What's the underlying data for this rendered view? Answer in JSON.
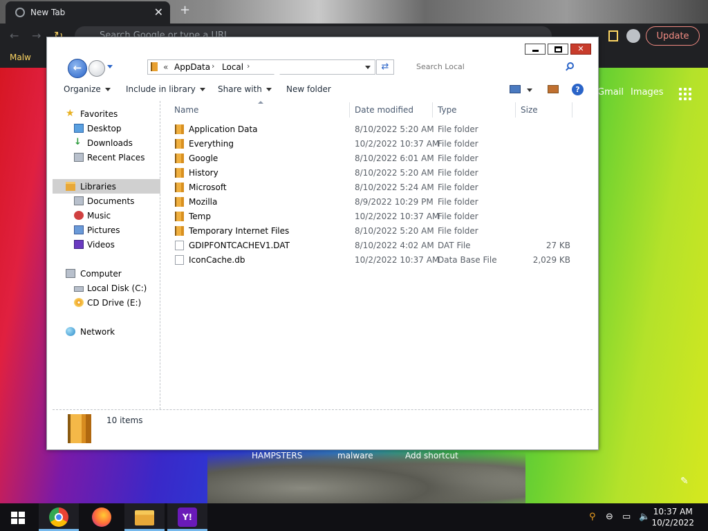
{
  "browser": {
    "tab_title": "New Tab",
    "tab_close": "✕",
    "new_tab": "+",
    "omnibox_placeholder": "Search Google or type a URL",
    "update_label": "Update",
    "bookmark": "Malw",
    "page_links": {
      "gmail": "Gmail",
      "images": "Images"
    },
    "shortcuts": [
      "HAMPSTERS",
      "malware",
      "Add shortcut"
    ]
  },
  "explorer": {
    "title_buttons": {
      "close": "✕"
    },
    "breadcrumb": {
      "prefix": "«",
      "items": [
        "AppData",
        "Local"
      ],
      "separator": "›"
    },
    "search_placeholder": "Search Local",
    "toolbar": {
      "organize": "Organize",
      "include_in_library": "Include in library",
      "share_with": "Share with",
      "new_folder": "New folder",
      "help": "?"
    },
    "nav": {
      "favorites": "Favorites",
      "desktop": "Desktop",
      "downloads": "Downloads",
      "recent_places": "Recent Places",
      "libraries": "Libraries",
      "documents": "Documents",
      "music": "Music",
      "pictures": "Pictures",
      "videos": "Videos",
      "computer": "Computer",
      "local_disk": "Local Disk (C:)",
      "cd_drive": "CD Drive (E:)",
      "network": "Network"
    },
    "columns": {
      "name": "Name",
      "date_modified": "Date modified",
      "type": "Type",
      "size": "Size"
    },
    "files": [
      {
        "name": "Application Data",
        "date": "8/10/2022 5:20 AM",
        "type": "File folder",
        "size": "",
        "icon": "special-folder-icon"
      },
      {
        "name": "Everything",
        "date": "10/2/2022 10:37 AM",
        "type": "File folder",
        "size": "",
        "icon": "folder-icon"
      },
      {
        "name": "Google",
        "date": "8/10/2022 6:01 AM",
        "type": "File folder",
        "size": "",
        "icon": "folder-icon"
      },
      {
        "name": "History",
        "date": "8/10/2022 5:20 AM",
        "type": "File folder",
        "size": "",
        "icon": "special-folder-icon"
      },
      {
        "name": "Microsoft",
        "date": "8/10/2022 5:24 AM",
        "type": "File folder",
        "size": "",
        "icon": "folder-icon"
      },
      {
        "name": "Mozilla",
        "date": "8/9/2022 10:29 PM",
        "type": "File folder",
        "size": "",
        "icon": "folder-icon"
      },
      {
        "name": "Temp",
        "date": "10/2/2022 10:37 AM",
        "type": "File folder",
        "size": "",
        "icon": "folder-icon"
      },
      {
        "name": "Temporary Internet Files",
        "date": "8/10/2022 5:20 AM",
        "type": "File folder",
        "size": "",
        "icon": "special-folder-icon"
      },
      {
        "name": "GDIPFONTCACHEV1.DAT",
        "date": "8/10/2022 4:02 AM",
        "type": "DAT File",
        "size": "27 KB",
        "icon": "file-icon"
      },
      {
        "name": "IconCache.db",
        "date": "10/2/2022 10:37 AM",
        "type": "Data Base File",
        "size": "2,029 KB",
        "icon": "file-icon"
      }
    ],
    "status": {
      "item_count": "10 items"
    }
  },
  "taskbar": {
    "yahoo_label": "Y!",
    "clock_time": "10:37 AM",
    "clock_date": "10/2/2022"
  }
}
